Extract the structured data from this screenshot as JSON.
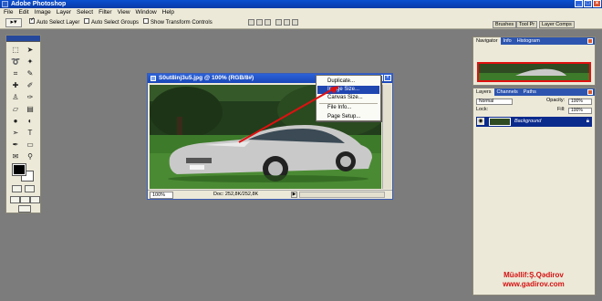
{
  "window": {
    "title": "Adobe Photoshop"
  },
  "menubar": [
    "File",
    "Edit",
    "Image",
    "Layer",
    "Select",
    "Filter",
    "View",
    "Window",
    "Help"
  ],
  "options_bar": {
    "auto_select_layer": {
      "label": "Auto Select Layer",
      "checked": true
    },
    "auto_select_groups": {
      "label": "Auto Select Groups",
      "checked": false
    },
    "show_transform_controls": {
      "label": "Show Transform Controls",
      "checked": false
    },
    "dock_tabs": [
      "Brushes",
      "Tool Pr",
      "Layer Comps"
    ]
  },
  "document": {
    "title": "S0ut8inj3u5.jpg @ 100% (RGB/8#)",
    "zoom": "100%",
    "doc_info": "Doc: 252,8K/252,8K"
  },
  "context_menu": {
    "items": [
      "Duplicate...",
      "Image Size...",
      "Canvas Size...",
      "File Info...",
      "Page Setup..."
    ],
    "highlighted": "Image Size..."
  },
  "navigator_panel": {
    "tabs": [
      "Navigator",
      "Info",
      "Histogram"
    ]
  },
  "layers_panel": {
    "tabs": [
      "Layers",
      "Channels",
      "Paths"
    ],
    "blend_mode": "Normal",
    "opacity_label": "Opacity:",
    "opacity_value": "100%",
    "lock_label": "Lock:",
    "fill_label": "Fill:",
    "fill_value": "100%",
    "layer_name": "Background"
  },
  "watermark": {
    "author": "Müəllif:Ş.Qədirov",
    "site": "www.gadirov.com"
  },
  "colors": {
    "accent_blue": "#0a3aa8",
    "ui_face": "#ece9d8",
    "workspace": "#7c7c7c",
    "watermark_red": "#d41010",
    "highlight": "#2046b0"
  }
}
